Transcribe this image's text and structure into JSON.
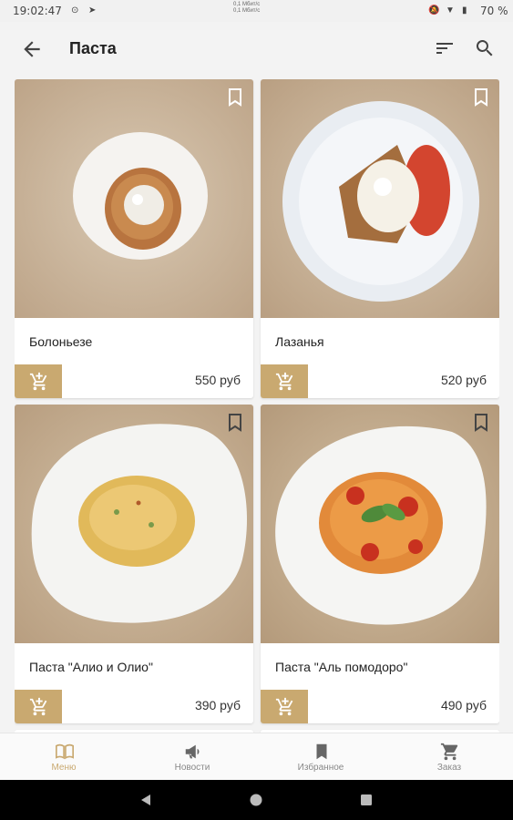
{
  "status_bar": {
    "time": "19:02:47",
    "network_line1": "0,1 Мбит/с",
    "network_line2": "0,1 Мбит/с",
    "battery": "70 %"
  },
  "header": {
    "title": "Паста",
    "back_icon": "arrow-left-icon",
    "sort_icon": "sort-icon",
    "search_icon": "search-icon"
  },
  "products": [
    {
      "name": "Болоньезе",
      "price": "550 руб"
    },
    {
      "name": "Лазанья",
      "price": "520 руб"
    },
    {
      "name": "Паста \"Алио и Олио\"",
      "price": "390 руб"
    },
    {
      "name": "Паста \"Аль помодоро\"",
      "price": "490 руб"
    }
  ],
  "bottom_nav": [
    {
      "label": "Меню",
      "icon": "book-icon",
      "active": true
    },
    {
      "label": "Новости",
      "icon": "megaphone-icon",
      "active": false
    },
    {
      "label": "Избранное",
      "icon": "bookmark-icon",
      "active": false
    },
    {
      "label": "Заказ",
      "icon": "cart-icon",
      "active": false
    }
  ],
  "colors": {
    "accent": "#c9a970",
    "background": "#f3f3f3",
    "card": "#ffffff",
    "text": "#222222"
  }
}
